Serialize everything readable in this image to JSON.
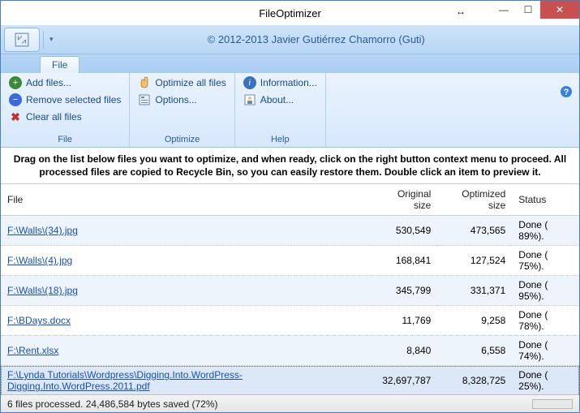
{
  "window": {
    "title": "FileOptimizer"
  },
  "copyright": "© 2012-2013 Javier Gutiérrez Chamorro (Guti)",
  "tabs": {
    "file": "File"
  },
  "ribbon": {
    "file": {
      "label": "File",
      "add": "Add files...",
      "remove": "Remove selected files",
      "clear": "Clear all files"
    },
    "optimize": {
      "label": "Optimize",
      "optimize_all": "Optimize all files",
      "options": "Options..."
    },
    "help": {
      "label": "Help",
      "information": "Information...",
      "about": "About..."
    }
  },
  "instruction": "Drag on the list below files you want to optimize, and when ready, click on the right button context menu to proceed. All processed files are copied to Recycle Bin, so you can easily restore them. Double click an item to preview it.",
  "columns": {
    "file": "File",
    "orig": "Original size",
    "opt": "Optimized size",
    "status": "Status"
  },
  "rows": [
    {
      "file": "F:\\Walls\\(34).jpg",
      "orig": "530,549",
      "opt": "473,565",
      "status": "Done ( 89%)."
    },
    {
      "file": "F:\\Walls\\(4).jpg",
      "orig": "168,841",
      "opt": "127,524",
      "status": "Done ( 75%)."
    },
    {
      "file": "F:\\Walls\\(18).jpg",
      "orig": "345,799",
      "opt": "331,371",
      "status": "Done ( 95%)."
    },
    {
      "file": "F:\\BDays.docx",
      "orig": "11,769",
      "opt": "9,258",
      "status": "Done ( 78%)."
    },
    {
      "file": "F:\\Rent.xlsx",
      "orig": "8,840",
      "opt": "6,558",
      "status": "Done ( 74%)."
    },
    {
      "file": "F:\\Lynda Tutorials\\Wordpress\\Digging.Into.WordPress-Digging.Into.WordPress.2011.pdf",
      "orig": "32,697,787",
      "opt": "8,328,725",
      "status": "Done ( 25%)."
    }
  ],
  "status": "6 files processed. 24,486,584 bytes saved (72%)"
}
